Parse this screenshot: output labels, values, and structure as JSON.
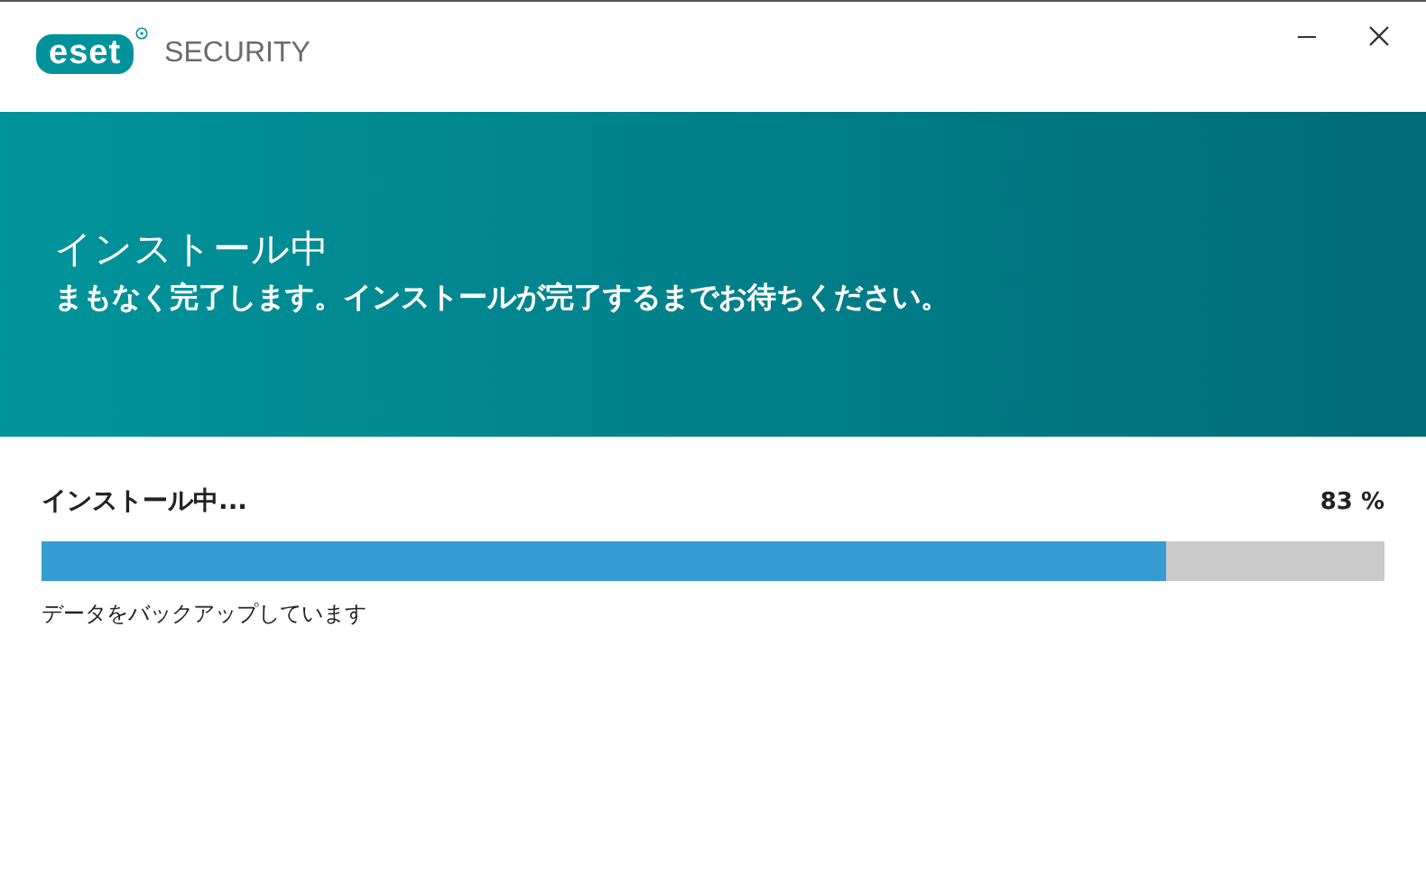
{
  "window": {
    "logo": "eset",
    "product": "SECURITY"
  },
  "banner": {
    "title": "インストール中",
    "subtitle": "まもなく完了します。インストールが完了するまでお待ちください。"
  },
  "progress": {
    "label": "インストール中...",
    "reading": "83 %",
    "level": 0.837,
    "status": "データをバックアップしています"
  }
}
